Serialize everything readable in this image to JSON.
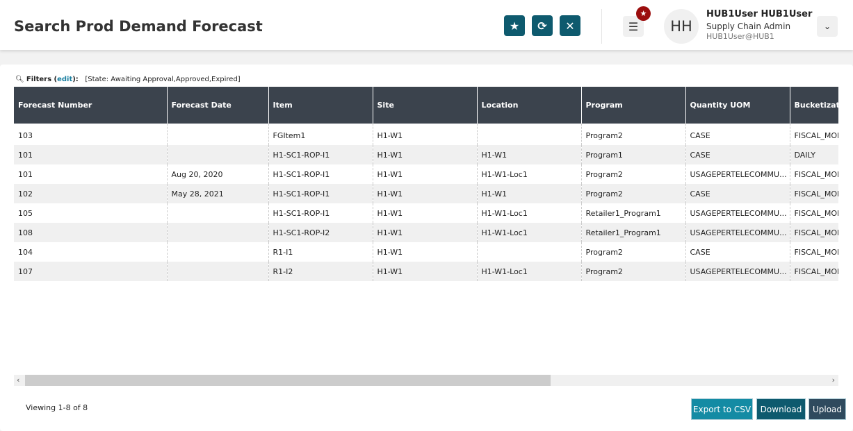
{
  "header": {
    "title": "Search Prod Demand Forecast",
    "user_name": "HUB1User HUB1User",
    "user_role": "Supply Chain Admin",
    "user_email": "HUB1User@HUB1",
    "avatar_initials": "HH"
  },
  "filters": {
    "label": "Filters (",
    "edit": "edit",
    "suffix": "):",
    "value": "[State: Awaiting Approval,Approved,Expired]"
  },
  "table": {
    "columns": [
      "Forecast Number",
      "Forecast Date",
      "Item",
      "Site",
      "Location",
      "Program",
      "Quantity UOM",
      "Bucketization"
    ],
    "rows": [
      [
        "103",
        "",
        "FGItem1",
        "H1-W1",
        "",
        "Program2",
        "CASE",
        "FISCAL_MONTH"
      ],
      [
        "101",
        "",
        "H1-SC1-ROP-I1",
        "H1-W1",
        "H1-W1",
        "Program1",
        "CASE",
        "DAILY"
      ],
      [
        "101",
        "Aug 20, 2020",
        "H1-SC1-ROP-I1",
        "H1-W1",
        "H1-W1-Loc1",
        "Program2",
        "USAGEPERTELECOMMU...",
        "FISCAL_MONTH"
      ],
      [
        "102",
        "May 28, 2021",
        "H1-SC1-ROP-I1",
        "H1-W1",
        "H1-W1",
        "Program2",
        "CASE",
        "FISCAL_MONTH"
      ],
      [
        "105",
        "",
        "H1-SC1-ROP-I1",
        "H1-W1",
        "H1-W1-Loc1",
        "Retailer1_Program1",
        "USAGEPERTELECOMMU...",
        "FISCAL_MONTH"
      ],
      [
        "108",
        "",
        "H1-SC1-ROP-I2",
        "H1-W1",
        "H1-W1-Loc1",
        "Retailer1_Program1",
        "USAGEPERTELECOMMU...",
        "FISCAL_MONTH"
      ],
      [
        "104",
        "",
        "R1-I1",
        "H1-W1",
        "",
        "Program2",
        "CASE",
        "FISCAL_MONTH"
      ],
      [
        "107",
        "",
        "R1-I2",
        "H1-W1",
        "H1-W1-Loc1",
        "Program2",
        "USAGEPERTELECOMMU...",
        "FISCAL_MONTH"
      ]
    ]
  },
  "footer": {
    "viewing": "Viewing 1-8 of 8",
    "export": "Export to CSV",
    "download": "Download",
    "upload": "Upload"
  },
  "colors": {
    "primary": "#0e5a6e",
    "header_bg": "#3b434d",
    "badge": "#9b0d0d"
  }
}
